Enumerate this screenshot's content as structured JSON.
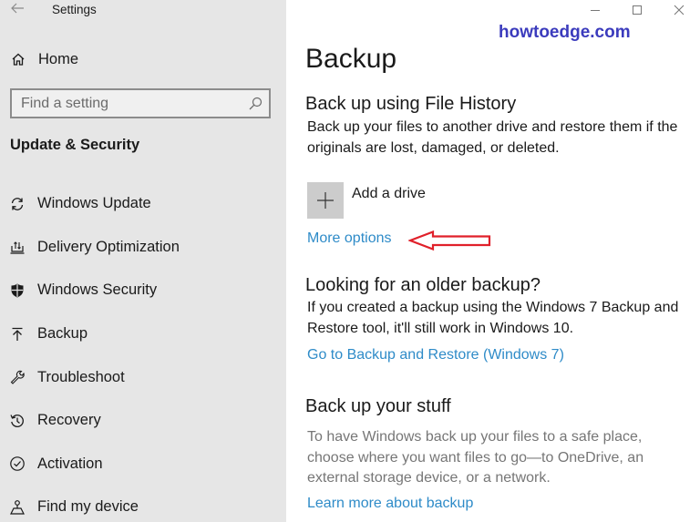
{
  "window": {
    "title": "Settings",
    "controls": {
      "minimize": "minimize",
      "maximize": "maximize",
      "close": "close"
    }
  },
  "watermark": "howtoedge.com",
  "sidebar": {
    "home_label": "Home",
    "search": {
      "placeholder": "Find a setting",
      "value": ""
    },
    "section_title": "Update & Security",
    "items": [
      {
        "label": "Windows Update",
        "icon": "sync-icon"
      },
      {
        "label": "Delivery Optimization",
        "icon": "delivery-optimization-icon"
      },
      {
        "label": "Windows Security",
        "icon": "shield-icon"
      },
      {
        "label": "Backup",
        "icon": "backup-arrow-up-icon"
      },
      {
        "label": "Troubleshoot",
        "icon": "wrench-icon"
      },
      {
        "label": "Recovery",
        "icon": "history-icon"
      },
      {
        "label": "Activation",
        "icon": "check-circle-icon"
      },
      {
        "label": "Find my device",
        "icon": "find-device-icon"
      }
    ]
  },
  "main": {
    "title": "Backup",
    "file_history": {
      "heading": "Back up using File History",
      "description": "Back up your files to another drive and restore them if the originals are lost, damaged, or deleted.",
      "add_drive_label": "Add a drive",
      "more_options_link": "More options"
    },
    "older_backup": {
      "heading": "Looking for an older backup?",
      "description": "If you created a backup using the Windows 7 Backup and Restore tool, it'll still work in Windows 10.",
      "link": "Go to Backup and Restore (Windows 7)"
    },
    "backup_stuff": {
      "heading": "Back up your stuff",
      "description": "To have Windows back up your files to a safe place, choose where you want files to go—to OneDrive, an external storage device, or a network.",
      "link": "Learn more about backup"
    }
  },
  "colors": {
    "sidebar_bg": "#e6e6e6",
    "link": "#2e8bc8",
    "watermark": "#3b3bbd",
    "annotation_arrow": "#e0202a"
  }
}
